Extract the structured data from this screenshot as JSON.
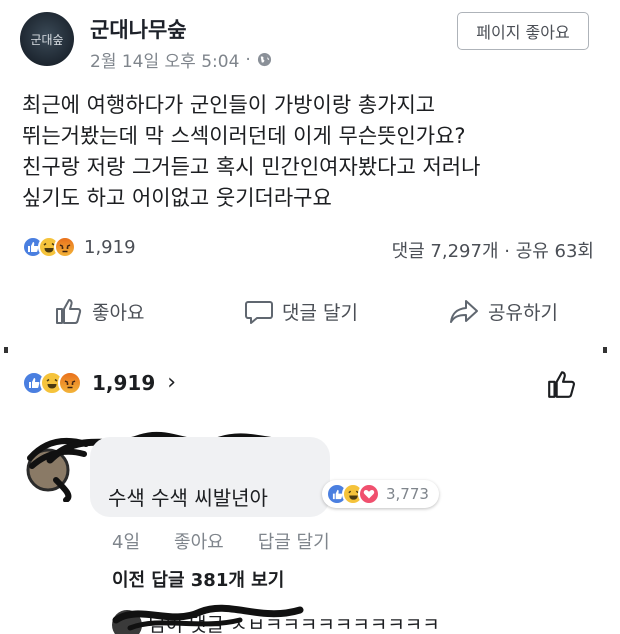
{
  "post": {
    "page_name": "군대나무숲",
    "avatar_text": "군대숲",
    "timestamp": "2월 14일 오후 5:04",
    "separator": "·",
    "like_page_button": "페이지 좋아요",
    "body_lines": [
      "최근에 여행하다가 군인들이 가방이랑 총가지고",
      "뛰는거봤는데 막 스섹이러던데 이게 무슨뜻인가요?",
      "친구랑 저랑 그거듣고 혹시 민간인여자봤다고 저러나",
      "싶기도 하고 어이없고 웃기더라구요"
    ],
    "reaction_count": "1,919",
    "comment_share_stats": "댓글 7,297개 · 공유 63회",
    "actions": {
      "like": "좋아요",
      "comment": "댓글 달기",
      "share": "공유하기"
    },
    "reaction_icons": [
      "like-icon",
      "haha-icon",
      "angry-icon"
    ]
  },
  "comments_section": {
    "reaction_count": "1,919",
    "chevron": "›",
    "top_comment": {
      "text": "수색 수색 씨발년아",
      "reaction_count": "3,773",
      "reaction_icons": [
        "like-icon",
        "haha-icon",
        "love-icon"
      ],
      "age": "4일",
      "like_action": "좋아요",
      "reply_action": "답글 달기"
    },
    "previous_replies": "이전 답글 381개 보기",
    "reply_preview": {
      "text": "님이 댓글 ㅅㅂㅋㅋㅋㅋㅋㅋㅋㅋㅋㅋ"
    }
  },
  "colors": {
    "like_blue": "#4a7fe0",
    "haha_yellow": "#f5c33b",
    "love_red": "#f0506e",
    "text_secondary": "#7f858c"
  }
}
